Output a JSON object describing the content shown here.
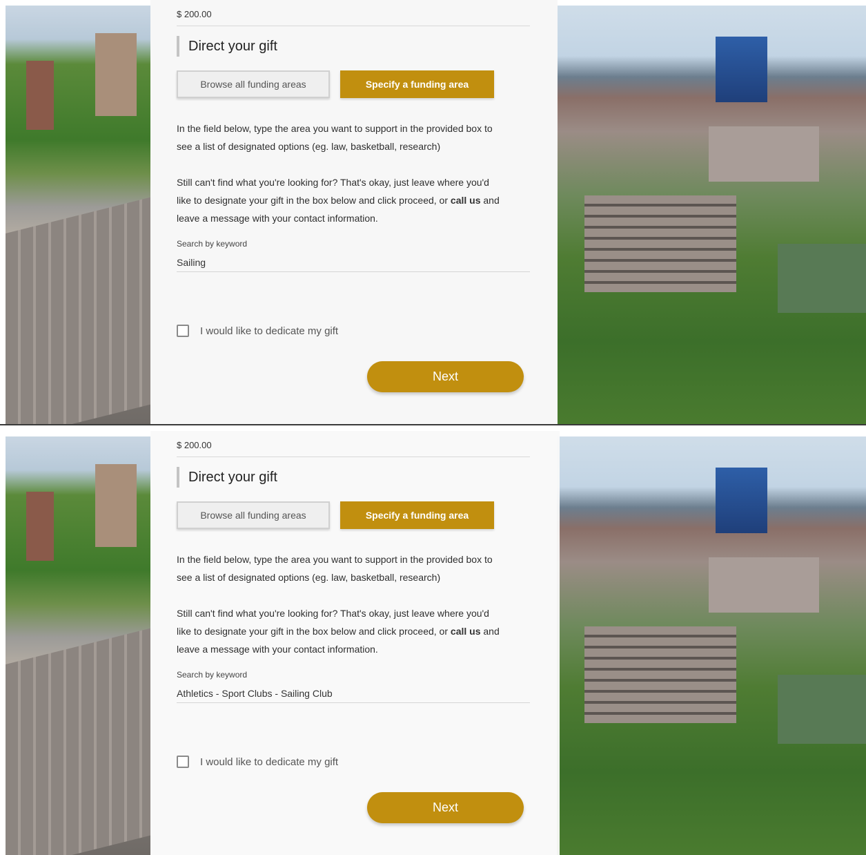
{
  "screens": [
    {
      "amount": "$ 200.00",
      "section_title": "Direct your gift",
      "browse_label": "Browse all funding areas",
      "specify_label": "Specify a funding area",
      "para1": "In the field below, type the area you want to support in the provided box to see a list of designated options (eg. law, basketball, research)",
      "para2_before": "Still can't find what you're looking for? That's okay, just leave where you'd like to designate your gift in the box below and click proceed, or ",
      "para2_link": "call us",
      "para2_after": " and leave a message with your contact information.",
      "search_label": "Search by keyword",
      "search_value": "Sailing",
      "dedicate_label": "I would like to dedicate my gift",
      "next_label": "Next"
    },
    {
      "amount": "$ 200.00",
      "section_title": "Direct your gift",
      "browse_label": "Browse all funding areas",
      "specify_label": "Specify a funding area",
      "para1": "In the field below, type the area you want to support in the provided box to see a list of designated options (eg. law, basketball, research)",
      "para2_before": "Still can't find what you're looking for? That's okay, just leave where you'd like to designate your gift in the box below and click proceed, or ",
      "para2_link": "call us",
      "para2_after": " and leave a message with your contact information.",
      "search_label": "Search by keyword",
      "search_value": "Athletics - Sport Clubs - Sailing Club",
      "dedicate_label": "I would like to dedicate my gift",
      "next_label": "Next"
    }
  ],
  "colors": {
    "accent": "#c18f0f",
    "panel_bg": "#f7f7f7",
    "text": "#2e2e2e"
  }
}
